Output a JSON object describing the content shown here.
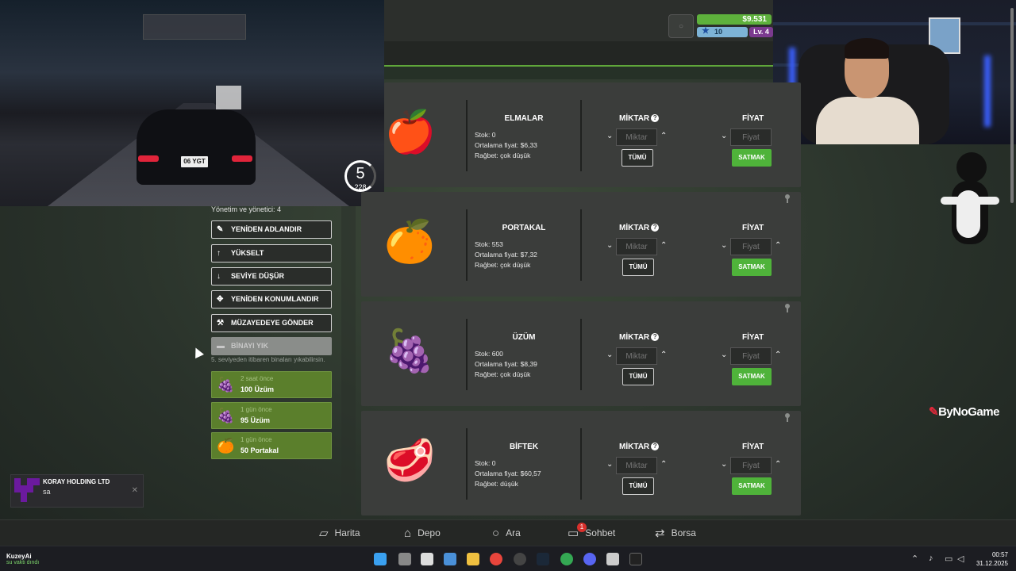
{
  "hud": {
    "money": "$9.531",
    "stars": "10",
    "level": "Lv. 4"
  },
  "stream": {
    "plate": "06 YGT",
    "gear": "5",
    "speed": "228",
    "logo_text": "ByNoGame"
  },
  "management": {
    "title": "Yönetim ve yönetici: 4",
    "buttons": [
      {
        "label": "YENİDEN ADLANDIR",
        "icon": "edit-icon"
      },
      {
        "label": "YÜKSELT",
        "icon": "arrow-up-icon"
      },
      {
        "label": "SEVİYE DÜŞÜR",
        "icon": "arrow-down-icon"
      },
      {
        "label": "YENİDEN KONUMLANDIR",
        "icon": "move-icon"
      },
      {
        "label": "MÜZAYEDEYE GÖNDER",
        "icon": "gavel-icon"
      },
      {
        "label": "BİNAYI YIK",
        "icon": "demolish-icon"
      }
    ],
    "demolish_note": "5. seviyeden itibaren binaları yıkabilirsin.",
    "history": [
      {
        "time": "2 saat önce",
        "amount": "100 Üzüm",
        "icon": "grapes-icon"
      },
      {
        "time": "1 gün önce",
        "amount": "95 Üzüm",
        "icon": "grapes-icon"
      },
      {
        "time": "1 gün önce",
        "amount": "50 Portakal",
        "icon": "orange-icon"
      }
    ]
  },
  "market": {
    "qty_header": "MİKTAR",
    "price_header": "FİYAT",
    "qty_placeholder": "Miktar",
    "price_placeholder": "Fiyat",
    "all_label": "TÜMÜ",
    "sell_label": "SATMAK",
    "items": [
      {
        "name": "ELMALAR",
        "stock": "Stok: 0",
        "avg": "Ortalama fiyat: $6,33",
        "demand": "Rağbet: çok düşük",
        "icon": "apple-icon"
      },
      {
        "name": "PORTAKAL",
        "stock": "Stok: 553",
        "avg": "Ortalama fiyat: $7,32",
        "demand": "Rağbet: çok düşük",
        "icon": "orange-icon"
      },
      {
        "name": "ÜZÜM",
        "stock": "Stok: 600",
        "avg": "Ortalama fiyat: $8,39",
        "demand": "Rağbet: çok düşük",
        "icon": "grapes-icon"
      },
      {
        "name": "BİFTEK",
        "stock": "Stok: 0",
        "avg": "Ortalama fiyat: $60,57",
        "demand": "Rağbet: düşük",
        "icon": "steak-icon"
      }
    ]
  },
  "notification": {
    "title": "KORAY HOLDING LTD",
    "message": "sa"
  },
  "bottom_nav": [
    {
      "label": "Harita",
      "icon": "map-icon"
    },
    {
      "label": "Depo",
      "icon": "warehouse-icon"
    },
    {
      "label": "Ara",
      "icon": "search-icon"
    },
    {
      "label": "Sohbet",
      "icon": "chat-icon",
      "badge": "1"
    },
    {
      "label": "Borsa",
      "icon": "exchange-icon"
    }
  ],
  "taskbar": {
    "weather_title": "KuzeyAi",
    "weather_sub": "su vakti dındı",
    "time": "00:57",
    "date": "31.12.2025"
  }
}
